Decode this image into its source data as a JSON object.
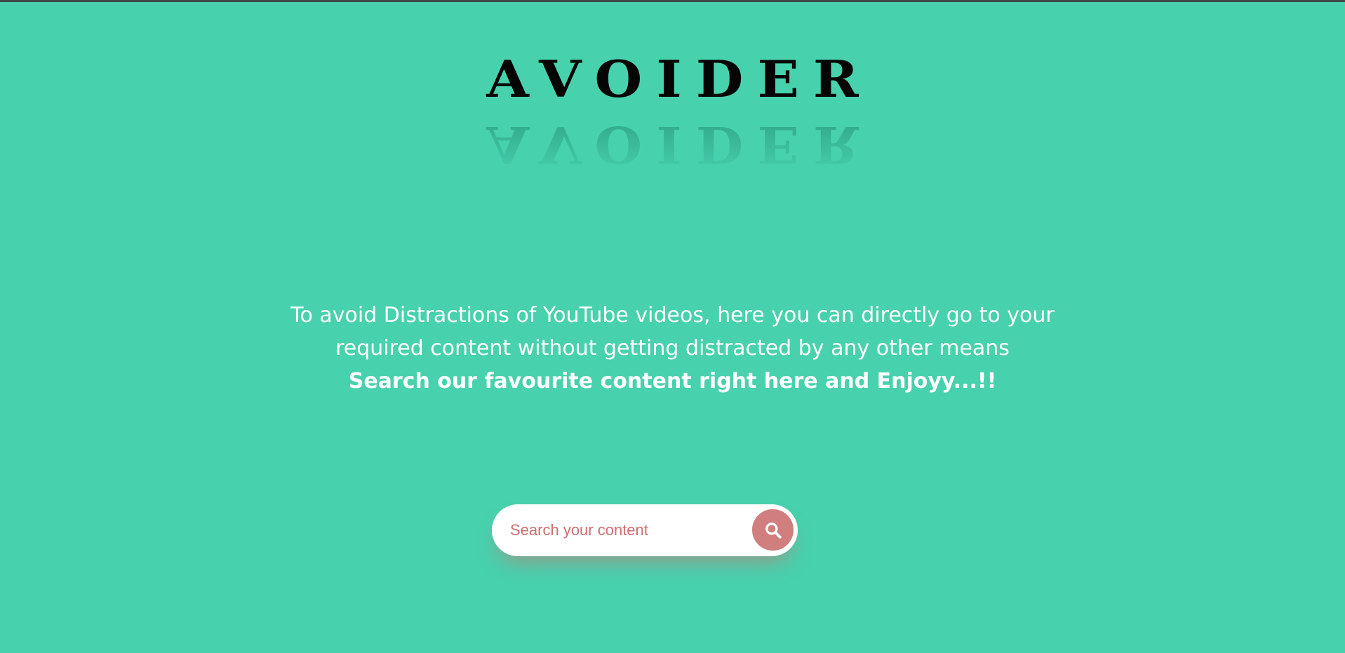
{
  "logo": {
    "text": "AVOIDER",
    "reflection_text": "AVOIDER"
  },
  "intro": {
    "line1": "To avoid Distractions of YouTube videos, here you can directly go to your",
    "line2": "required content without getting distracted by any other means",
    "cta": "Search our favourite content right here and Enjoyy...!!"
  },
  "search": {
    "placeholder": "Search your content",
    "value": "",
    "button_icon": "search-icon"
  },
  "colors": {
    "background": "#48d1ad",
    "logo": "#050505",
    "text": "#ffffff",
    "accent": "#d07e7e",
    "placeholder": "#d06e6e"
  }
}
